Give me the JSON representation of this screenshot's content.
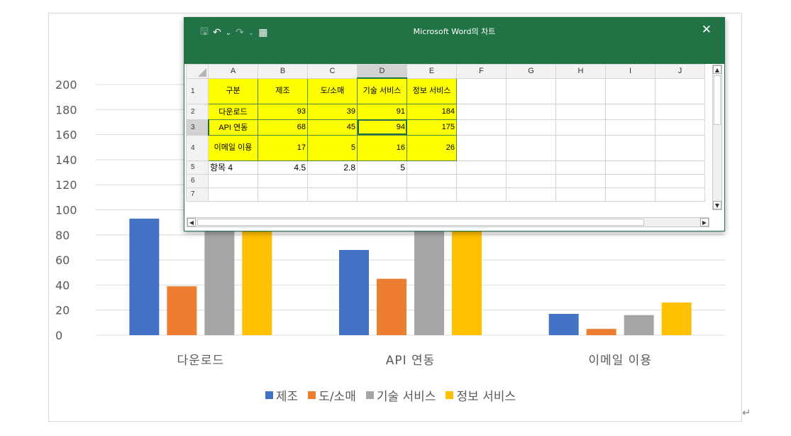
{
  "window": {
    "title": "Microsoft Word의 차트",
    "close_glyph": "✕",
    "quick_access": {
      "save_glyph": "🖫",
      "undo_glyph": "↶",
      "redo_glyph": "↷",
      "dropdown_glyph": "⌄",
      "table_glyph": "▦"
    }
  },
  "sheet": {
    "columns": [
      "A",
      "B",
      "C",
      "D",
      "E",
      "F",
      "G",
      "H",
      "I",
      "J"
    ],
    "rows": [
      {
        "num": "1",
        "cells": [
          "구분",
          "제조",
          "도/소매",
          "기술 서비스",
          "정보 서비스"
        ]
      },
      {
        "num": "2",
        "cells": [
          "다운로드",
          "93",
          "39",
          "91",
          "184"
        ]
      },
      {
        "num": "3",
        "cells": [
          "API 연동",
          "68",
          "45",
          "94",
          "175"
        ]
      },
      {
        "num": "4",
        "cells": [
          "이메일 이용",
          "17",
          "5",
          "16",
          "26"
        ]
      },
      {
        "num": "5",
        "cells": [
          "항목 4",
          "4.5",
          "2.8",
          "5",
          ""
        ]
      },
      {
        "num": "6",
        "cells": [
          "",
          "",
          "",
          "",
          ""
        ]
      },
      {
        "num": "7",
        "cells": [
          "",
          "",
          "",
          "",
          ""
        ]
      }
    ]
  },
  "chart_data": {
    "type": "bar",
    "categories": [
      "다운로드",
      "API 연동",
      "이메일 이용"
    ],
    "series": [
      {
        "name": "제조",
        "values": [
          93,
          68,
          17
        ],
        "color": "#4472C4"
      },
      {
        "name": "도/소매",
        "values": [
          39,
          45,
          5
        ],
        "color": "#ED7D31"
      },
      {
        "name": "기술 서비스",
        "values": [
          91,
          94,
          16
        ],
        "color": "#A5A5A5"
      },
      {
        "name": "정보 서비스",
        "values": [
          184,
          175,
          26
        ],
        "color": "#FFC000"
      }
    ],
    "yticks": [
      "0",
      "20",
      "40",
      "60",
      "80",
      "100",
      "120",
      "140",
      "160",
      "180",
      "200"
    ],
    "ylim": [
      0,
      200
    ],
    "grid": true,
    "legend": "bottom"
  },
  "paragraph_mark": "↵"
}
